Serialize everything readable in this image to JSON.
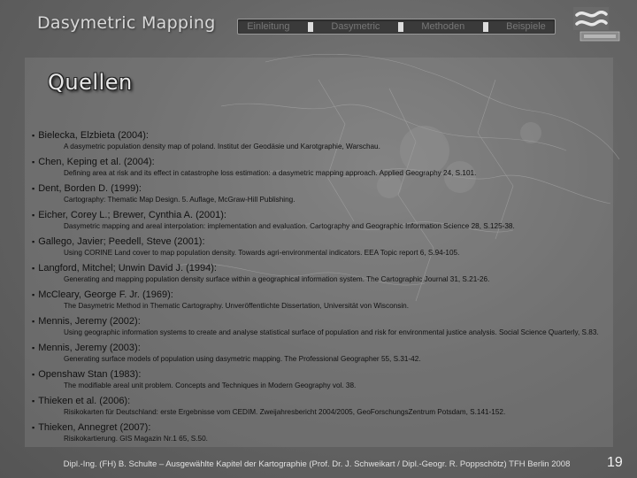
{
  "header": {
    "title": "Dasymetric Mapping"
  },
  "nav": {
    "tabs": [
      "Einleitung",
      "Dasymetric",
      "Methoden",
      "Beispiele"
    ]
  },
  "page": {
    "title": "Quellen",
    "number": "19"
  },
  "references": [
    {
      "author": "Bielecka, Elzbieta (2004):",
      "detail": "A dasymetric population density map of poland. Institut der Geodäsie und Karotgraphie, Warschau."
    },
    {
      "author": "Chen, Keping et al. (2004):",
      "detail": "Defining area at risk and its effect in catastrophe loss estimation: a dasymetric mapping approach. Applied Geography 24, S.101."
    },
    {
      "author": "Dent, Borden D. (1999):",
      "detail": "Cartography: Thematic Map Design. 5. Auflage, McGraw-Hill Publishing."
    },
    {
      "author": "Eicher, Corey L.; Brewer, Cynthia A. (2001):",
      "detail": "Dasymetric mapping and areal interpolation: implementation and evaluation. Cartography and Geographic Information Science 28, S.125-38."
    },
    {
      "author": "Gallego, Javier; Peedell, Steve (2001):",
      "detail": "Using CORINE Land cover to map population density. Towards agri-environmental indicators. EEA Topic report 6, S.94-105."
    },
    {
      "author": "Langford, Mitchel; Unwin David J. (1994):",
      "detail": "Generating and mapping population density surface within a geographical information system. The Cartographic Journal 31, S.21-26."
    },
    {
      "author": "McCleary, George F. Jr. (1969):",
      "detail": "The Dasymetric Method in Thematic Cartography. Unveröffentlichte Dissertation, Universität von Wisconsin."
    },
    {
      "author": "Mennis, Jeremy (2002):",
      "detail": "Using geographic information systems to create and analyse statistical surface of population and risk for environmental justice analysis. Social Science Quarterly, S.83."
    },
    {
      "author": "Mennis, Jeremy (2003):",
      "detail": "Generating surface models of population using dasymetric mapping. The Professional Geographer 55, S.31-42."
    },
    {
      "author": "Openshaw Stan (1983):",
      "detail": "The modifiable areal unit problem. Concepts and Techniques in Modern Geography vol. 38."
    },
    {
      "author": "Thieken et al. (2006):",
      "detail": "Risikokarten für Deutschland: erste Ergebnisse vom CEDIM. Zweijahresbericht 2004/2005, GeoForschungsZentrum Potsdam, S.141-152."
    },
    {
      "author": "Thieken, Annegret (2007):",
      "detail": "Risikokartierung. GIS Magazin Nr.1 65, S.50."
    }
  ],
  "footer": {
    "text": "Dipl.-Ing. (FH) B. Schulte – Ausgewählte Kapitel der Kartographie (Prof. Dr. J. Schweikart / Dipl.-Geogr. R. Poppschötz) TFH Berlin 2008"
  }
}
